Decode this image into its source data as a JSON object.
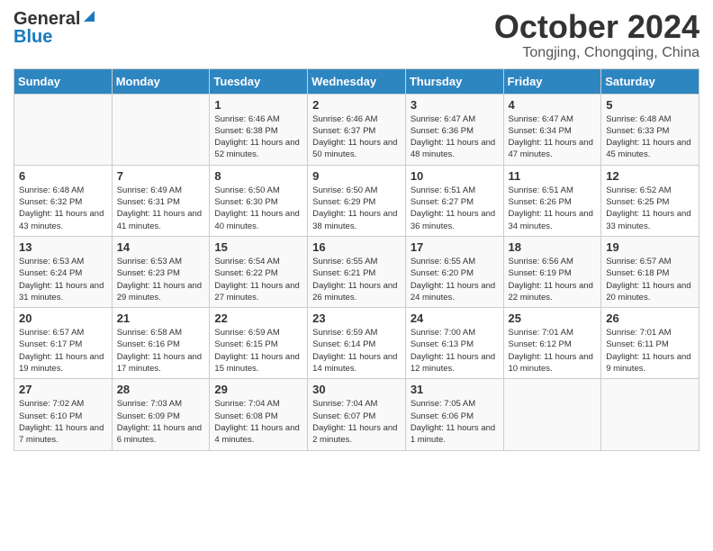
{
  "header": {
    "logo_general": "General",
    "logo_blue": "Blue",
    "month_title": "October 2024",
    "location": "Tongjing, Chongqing, China"
  },
  "weekdays": [
    "Sunday",
    "Monday",
    "Tuesday",
    "Wednesday",
    "Thursday",
    "Friday",
    "Saturday"
  ],
  "rows": [
    [
      {
        "day": "",
        "info": ""
      },
      {
        "day": "",
        "info": ""
      },
      {
        "day": "1",
        "info": "Sunrise: 6:46 AM\nSunset: 6:38 PM\nDaylight: 11 hours and 52 minutes."
      },
      {
        "day": "2",
        "info": "Sunrise: 6:46 AM\nSunset: 6:37 PM\nDaylight: 11 hours and 50 minutes."
      },
      {
        "day": "3",
        "info": "Sunrise: 6:47 AM\nSunset: 6:36 PM\nDaylight: 11 hours and 48 minutes."
      },
      {
        "day": "4",
        "info": "Sunrise: 6:47 AM\nSunset: 6:34 PM\nDaylight: 11 hours and 47 minutes."
      },
      {
        "day": "5",
        "info": "Sunrise: 6:48 AM\nSunset: 6:33 PM\nDaylight: 11 hours and 45 minutes."
      }
    ],
    [
      {
        "day": "6",
        "info": "Sunrise: 6:48 AM\nSunset: 6:32 PM\nDaylight: 11 hours and 43 minutes."
      },
      {
        "day": "7",
        "info": "Sunrise: 6:49 AM\nSunset: 6:31 PM\nDaylight: 11 hours and 41 minutes."
      },
      {
        "day": "8",
        "info": "Sunrise: 6:50 AM\nSunset: 6:30 PM\nDaylight: 11 hours and 40 minutes."
      },
      {
        "day": "9",
        "info": "Sunrise: 6:50 AM\nSunset: 6:29 PM\nDaylight: 11 hours and 38 minutes."
      },
      {
        "day": "10",
        "info": "Sunrise: 6:51 AM\nSunset: 6:27 PM\nDaylight: 11 hours and 36 minutes."
      },
      {
        "day": "11",
        "info": "Sunrise: 6:51 AM\nSunset: 6:26 PM\nDaylight: 11 hours and 34 minutes."
      },
      {
        "day": "12",
        "info": "Sunrise: 6:52 AM\nSunset: 6:25 PM\nDaylight: 11 hours and 33 minutes."
      }
    ],
    [
      {
        "day": "13",
        "info": "Sunrise: 6:53 AM\nSunset: 6:24 PM\nDaylight: 11 hours and 31 minutes."
      },
      {
        "day": "14",
        "info": "Sunrise: 6:53 AM\nSunset: 6:23 PM\nDaylight: 11 hours and 29 minutes."
      },
      {
        "day": "15",
        "info": "Sunrise: 6:54 AM\nSunset: 6:22 PM\nDaylight: 11 hours and 27 minutes."
      },
      {
        "day": "16",
        "info": "Sunrise: 6:55 AM\nSunset: 6:21 PM\nDaylight: 11 hours and 26 minutes."
      },
      {
        "day": "17",
        "info": "Sunrise: 6:55 AM\nSunset: 6:20 PM\nDaylight: 11 hours and 24 minutes."
      },
      {
        "day": "18",
        "info": "Sunrise: 6:56 AM\nSunset: 6:19 PM\nDaylight: 11 hours and 22 minutes."
      },
      {
        "day": "19",
        "info": "Sunrise: 6:57 AM\nSunset: 6:18 PM\nDaylight: 11 hours and 20 minutes."
      }
    ],
    [
      {
        "day": "20",
        "info": "Sunrise: 6:57 AM\nSunset: 6:17 PM\nDaylight: 11 hours and 19 minutes."
      },
      {
        "day": "21",
        "info": "Sunrise: 6:58 AM\nSunset: 6:16 PM\nDaylight: 11 hours and 17 minutes."
      },
      {
        "day": "22",
        "info": "Sunrise: 6:59 AM\nSunset: 6:15 PM\nDaylight: 11 hours and 15 minutes."
      },
      {
        "day": "23",
        "info": "Sunrise: 6:59 AM\nSunset: 6:14 PM\nDaylight: 11 hours and 14 minutes."
      },
      {
        "day": "24",
        "info": "Sunrise: 7:00 AM\nSunset: 6:13 PM\nDaylight: 11 hours and 12 minutes."
      },
      {
        "day": "25",
        "info": "Sunrise: 7:01 AM\nSunset: 6:12 PM\nDaylight: 11 hours and 10 minutes."
      },
      {
        "day": "26",
        "info": "Sunrise: 7:01 AM\nSunset: 6:11 PM\nDaylight: 11 hours and 9 minutes."
      }
    ],
    [
      {
        "day": "27",
        "info": "Sunrise: 7:02 AM\nSunset: 6:10 PM\nDaylight: 11 hours and 7 minutes."
      },
      {
        "day": "28",
        "info": "Sunrise: 7:03 AM\nSunset: 6:09 PM\nDaylight: 11 hours and 6 minutes."
      },
      {
        "day": "29",
        "info": "Sunrise: 7:04 AM\nSunset: 6:08 PM\nDaylight: 11 hours and 4 minutes."
      },
      {
        "day": "30",
        "info": "Sunrise: 7:04 AM\nSunset: 6:07 PM\nDaylight: 11 hours and 2 minutes."
      },
      {
        "day": "31",
        "info": "Sunrise: 7:05 AM\nSunset: 6:06 PM\nDaylight: 11 hours and 1 minute."
      },
      {
        "day": "",
        "info": ""
      },
      {
        "day": "",
        "info": ""
      }
    ]
  ]
}
